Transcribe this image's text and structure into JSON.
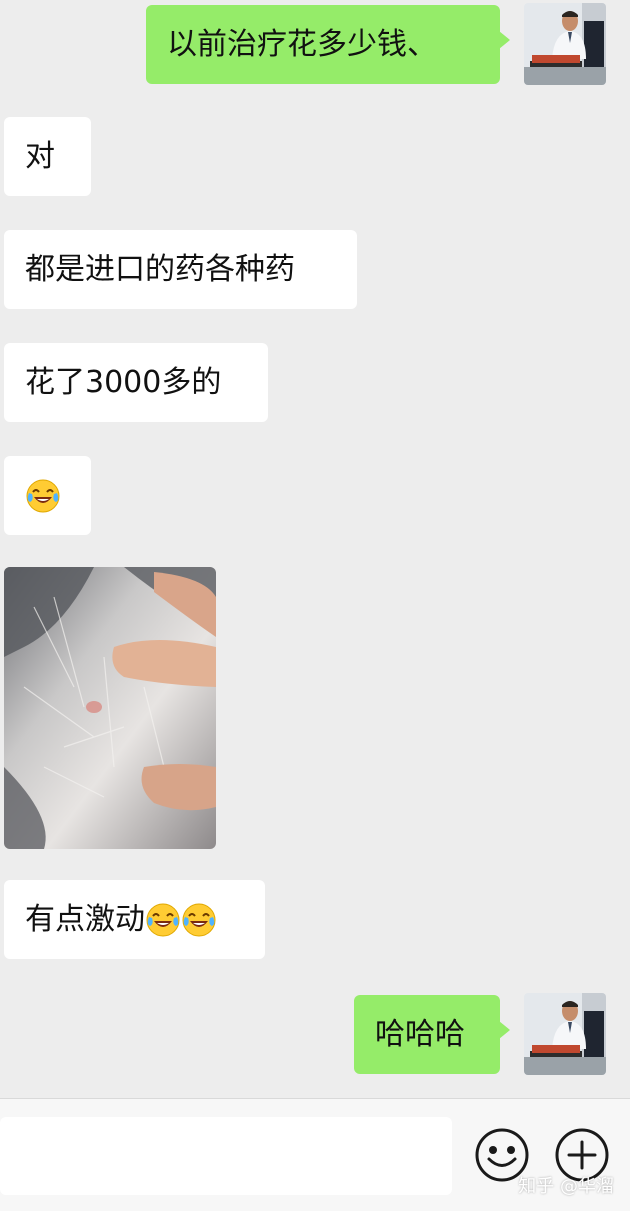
{
  "messages": [
    {
      "side": "right",
      "type": "text",
      "text": "以前治疗花多少钱、"
    },
    {
      "side": "left",
      "type": "text",
      "text": "对"
    },
    {
      "side": "left",
      "type": "text",
      "text": "都是进口的药各种药"
    },
    {
      "side": "left",
      "type": "text",
      "text": "花了3000多的"
    },
    {
      "side": "left",
      "type": "emoji",
      "emoji": "face-with-tears-icon"
    },
    {
      "side": "left",
      "type": "image",
      "description": "photo-of-pet-fur"
    },
    {
      "side": "left",
      "type": "text",
      "text": "有点激动"
    },
    {
      "side": "right",
      "type": "text",
      "text": "哈哈哈"
    }
  ],
  "input_bar": {
    "emoji_button_icon": "smiley-icon",
    "more_button_icon": "plus-circle-icon"
  },
  "watermark": "知乎 @华溜",
  "colors": {
    "background": "#ededed",
    "sent_bubble": "#95ec69",
    "received_bubble": "#ffffff",
    "input_bar": "#f7f7f7"
  }
}
